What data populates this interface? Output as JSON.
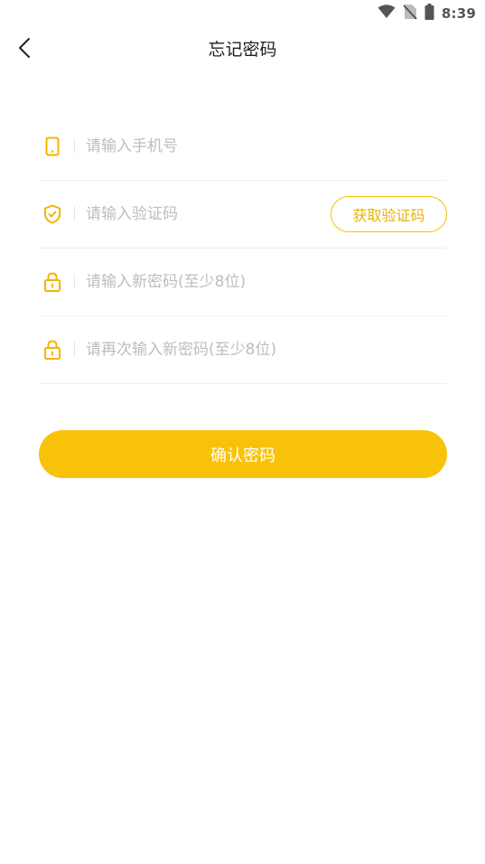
{
  "status_bar": {
    "time": "8:39",
    "icons": [
      "wifi-icon",
      "no-sim-icon",
      "battery-icon"
    ]
  },
  "header": {
    "title": "忘记密码",
    "back_icon": "chevron-left-icon"
  },
  "form": {
    "phone": {
      "icon": "phone-icon",
      "placeholder": "请输入手机号",
      "value": ""
    },
    "code": {
      "icon": "shield-check-icon",
      "placeholder": "请输入验证码",
      "value": "",
      "button_label": "获取验证码"
    },
    "new_password": {
      "icon": "lock-icon",
      "placeholder": "请输入新密码(至少8位)",
      "value": ""
    },
    "confirm_password": {
      "icon": "lock-icon",
      "placeholder": "请再次输入新密码(至少8位)",
      "value": ""
    }
  },
  "confirm_button": {
    "label": "确认密码"
  },
  "colors": {
    "accent": "#F8C20A",
    "accent_text": "#E8B400",
    "placeholder": "#BDBDBD",
    "divider": "#EEEEEE",
    "title": "#222222"
  }
}
